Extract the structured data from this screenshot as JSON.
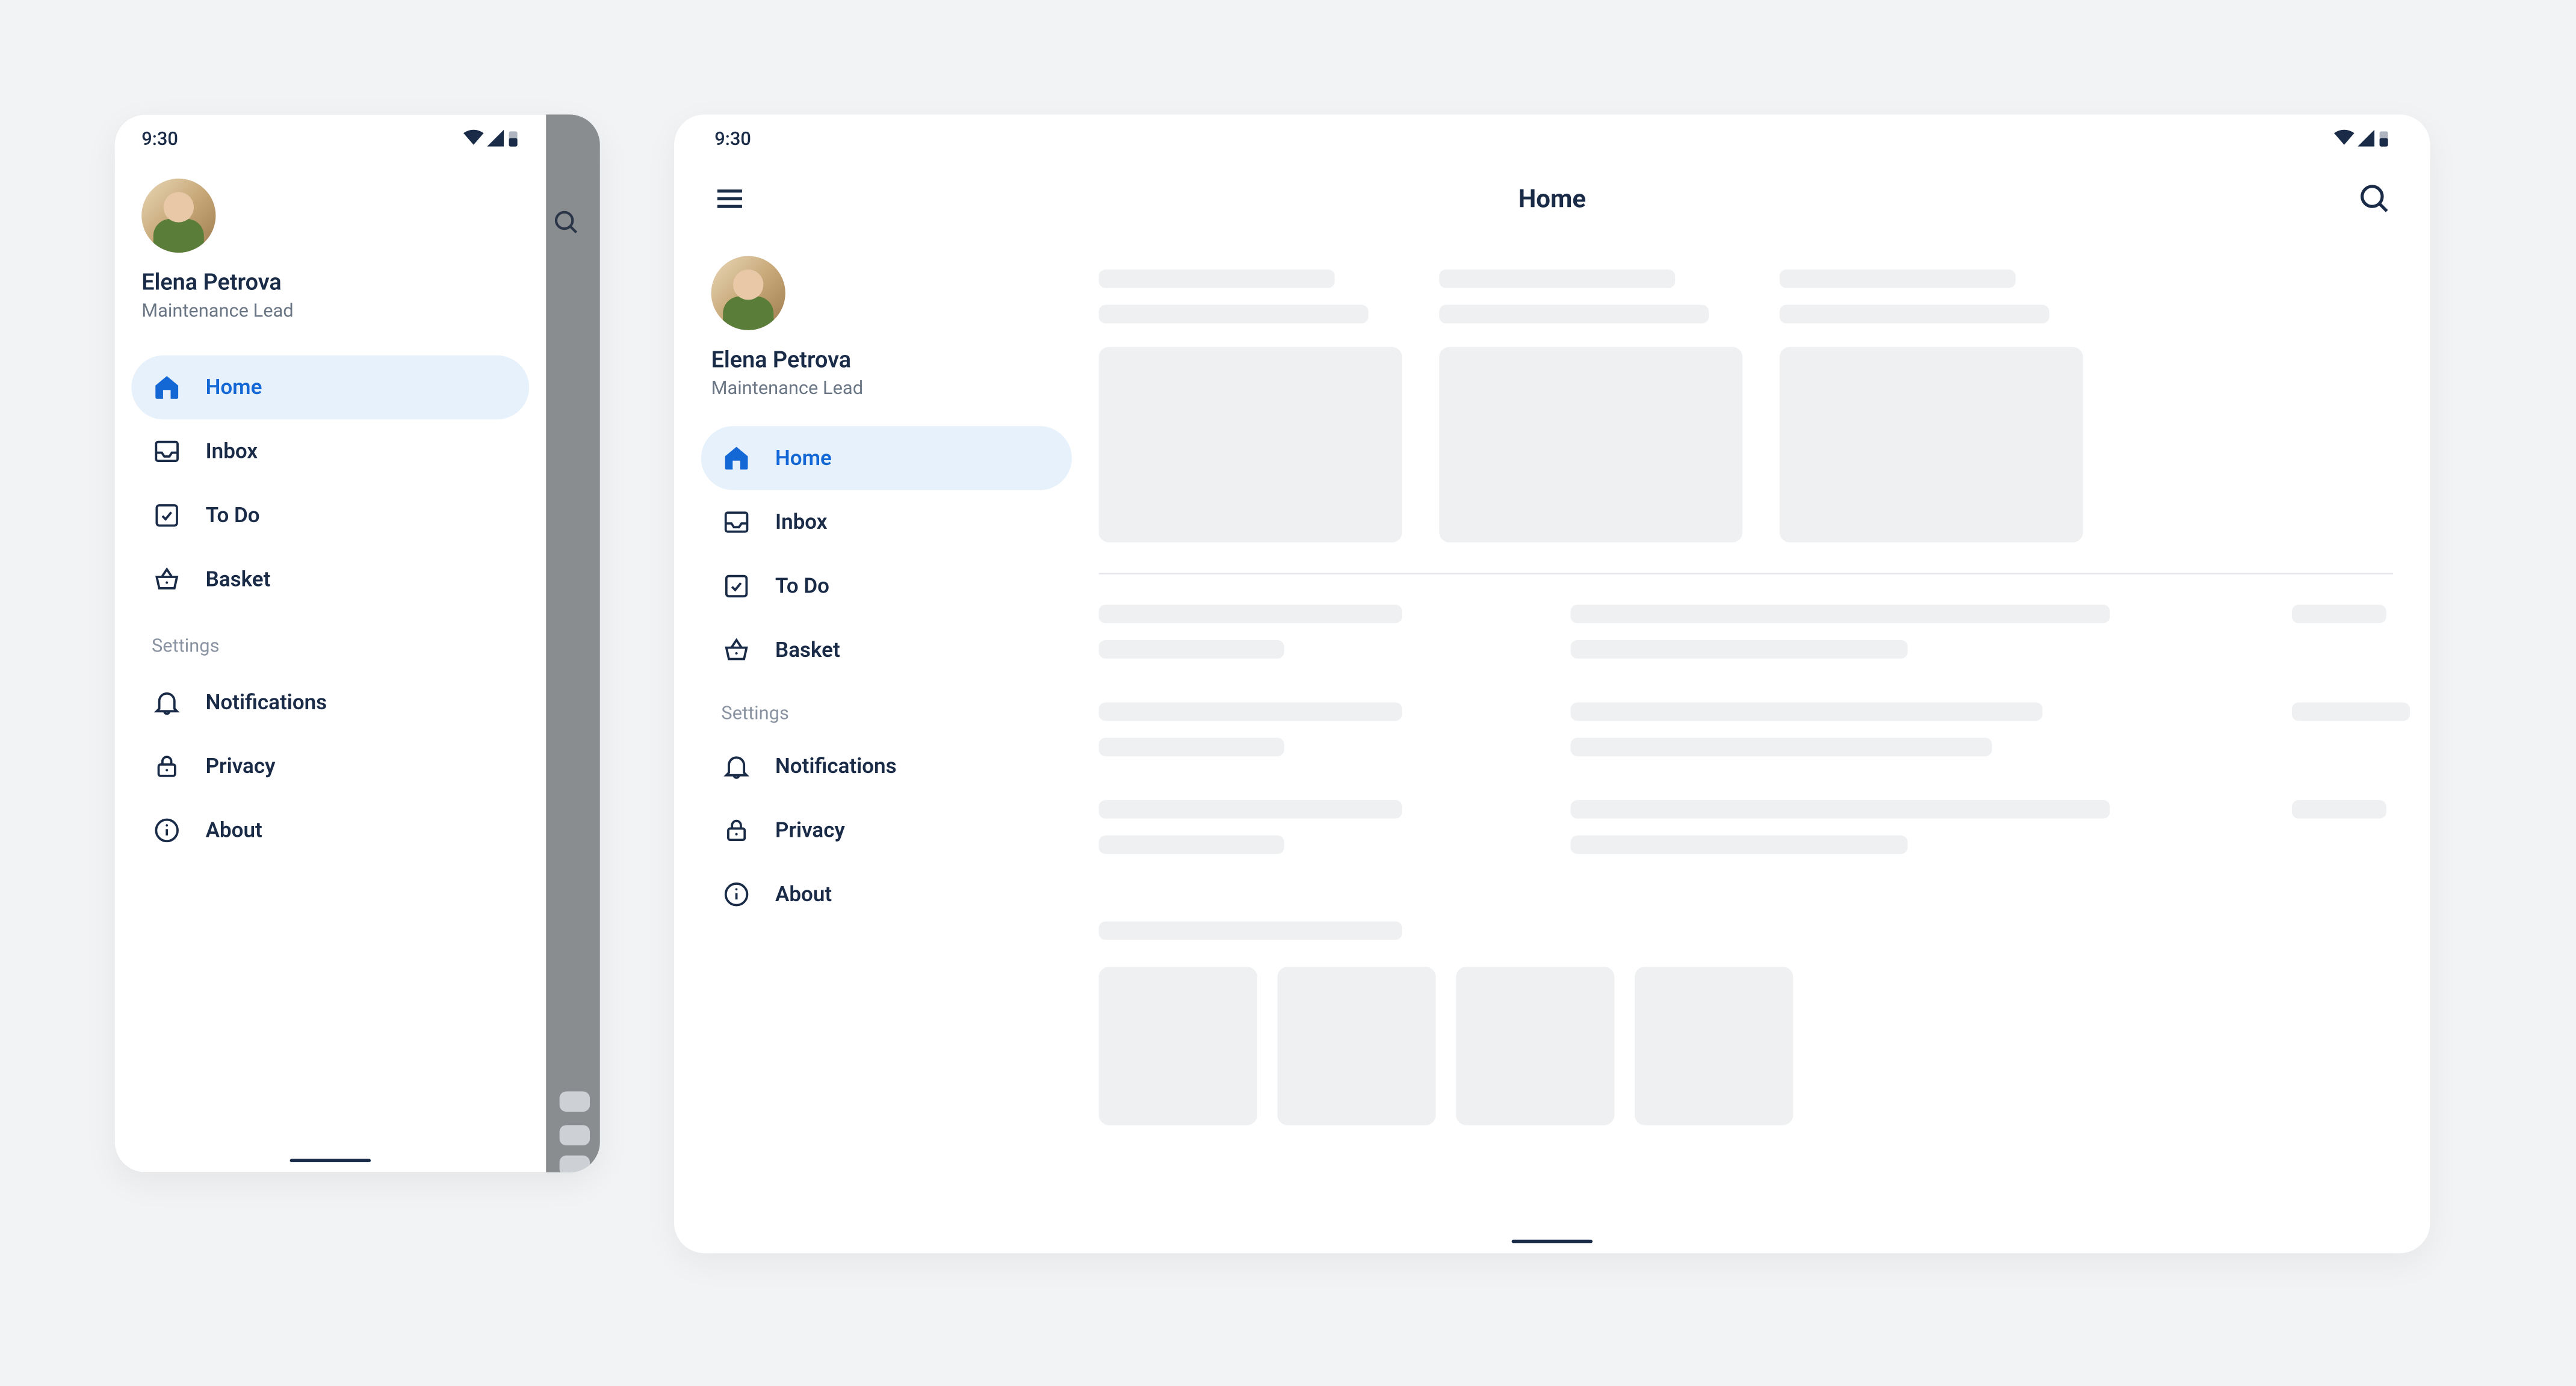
{
  "statusTime": "9:30",
  "appbarTitle": "Home",
  "user": {
    "name": "Elena Petrova",
    "role": "Maintenance Lead"
  },
  "navMain": [
    {
      "label": "Home",
      "icon": "home",
      "active": true
    },
    {
      "label": "Inbox",
      "icon": "inbox",
      "active": false
    },
    {
      "label": "To Do",
      "icon": "todo",
      "active": false
    },
    {
      "label": "Basket",
      "icon": "basket",
      "active": false
    }
  ],
  "settingsHeader": "Settings",
  "navSettings": [
    {
      "label": "Notifications",
      "icon": "bell"
    },
    {
      "label": "Privacy",
      "icon": "lock"
    },
    {
      "label": "About",
      "icon": "info"
    }
  ]
}
